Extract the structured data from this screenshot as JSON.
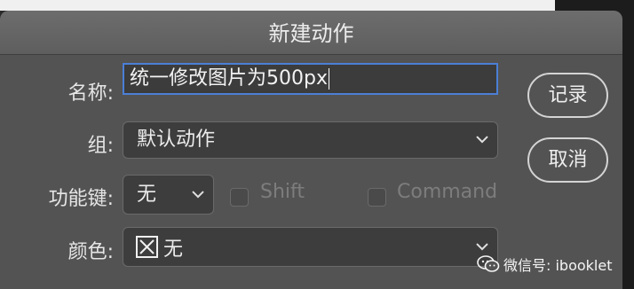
{
  "dialog": {
    "title": "新建动作",
    "name_label": "名称:",
    "name_value": "统一修改图片为500px",
    "group_label": "组:",
    "group_value": "默认动作",
    "function_key_label": "功能键:",
    "function_key_value": "无",
    "shift_label": "Shift",
    "command_label": "Command",
    "color_label": "颜色:",
    "color_value": "无",
    "record_button": "记录",
    "cancel_button": "取消"
  },
  "watermark": {
    "text": "微信号: ibooklet"
  },
  "icons": [
    "chevron-down-icon",
    "x-box-icon",
    "wechat-icon"
  ]
}
